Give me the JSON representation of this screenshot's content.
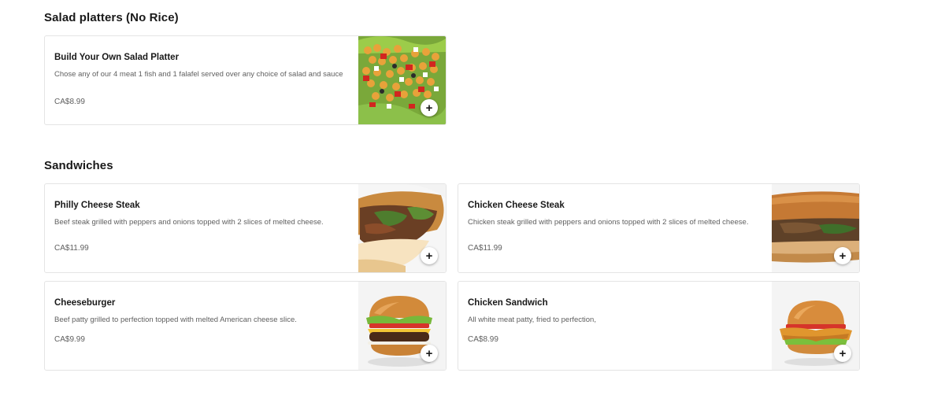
{
  "sections": [
    {
      "title": "Salad platters (No Rice)",
      "items": [
        {
          "name": "Build Your Own Salad Platter",
          "description": "Chose any of our 4 meat 1 fish and 1 falafel served over any choice of salad and sauce",
          "price": "CA$8.99",
          "image_icon": "salad-image",
          "add_label": "+"
        }
      ]
    },
    {
      "title": "Sandwiches",
      "items": [
        {
          "name": "Philly Cheese Steak",
          "description": "Beef steak grilled with peppers and onions topped with 2 slices of melted cheese.",
          "price": "CA$11.99",
          "image_icon": "philly-sandwich-image",
          "add_label": "+"
        },
        {
          "name": "Chicken Cheese Steak",
          "description": "Chicken steak grilled with peppers and onions topped with 2 slices of melted cheese.",
          "price": "CA$11.99",
          "image_icon": "chicken-sub-image",
          "add_label": "+"
        },
        {
          "name": "Cheeseburger",
          "description": "Beef patty grilled to perfection topped with melted American cheese slice.",
          "price": "CA$9.99",
          "image_icon": "burger-image",
          "add_label": "+"
        },
        {
          "name": "Chicken Sandwich",
          "description": "All white meat patty, fried to perfection,",
          "price": "CA$8.99",
          "image_icon": "chicken-burger-image",
          "add_label": "+"
        }
      ]
    }
  ]
}
